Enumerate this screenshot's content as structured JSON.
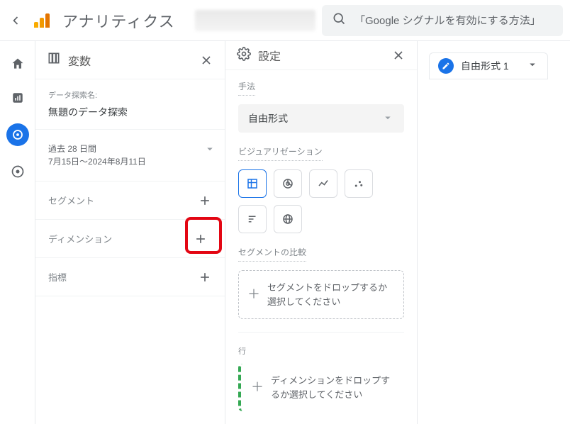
{
  "header": {
    "app_title": "アナリティクス",
    "search_text": "「Google シグナルを有効にする方法」"
  },
  "vars_panel": {
    "title": "変数",
    "exploration_name_label": "データ探索名:",
    "exploration_name_value": "無題のデータ探索",
    "date_range_label": "過去 28 日間",
    "date_range_value": "7月15日～2024年8月11日",
    "segments_label": "セグメント",
    "dimensions_label": "ディメンション",
    "metrics_label": "指標"
  },
  "settings_panel": {
    "title": "設定",
    "technique_label": "手法",
    "technique_value": "自由形式",
    "viz_label": "ビジュアリゼーション",
    "segment_compare_label": "セグメントの比較",
    "segment_drop_text": "セグメントをドロップするか選択してください",
    "rows_label": "行",
    "dimension_drop_text": "ディメンションをドロップするか選択してください"
  },
  "right": {
    "tab_name": "自由形式 1"
  }
}
